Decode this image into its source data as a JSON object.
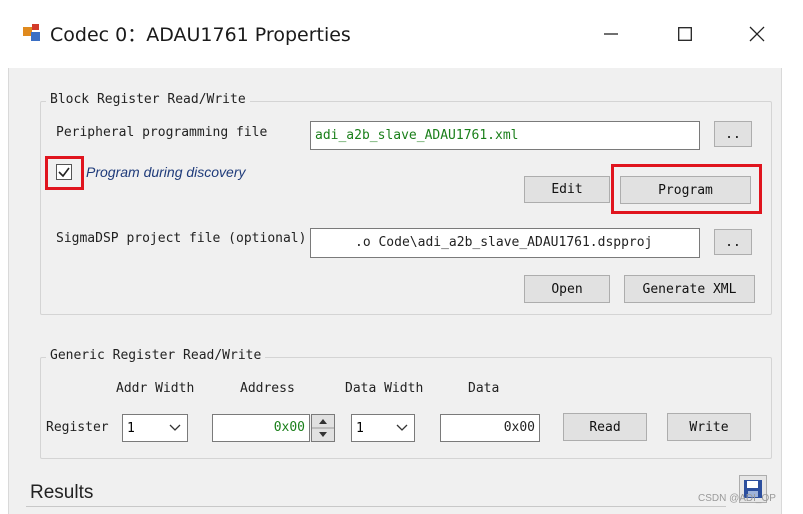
{
  "window": {
    "title": "Codec 0：ADAU1761 Properties",
    "controls": [
      "minimize-icon",
      "maximize-icon",
      "close-icon"
    ]
  },
  "block_rw": {
    "legend": "Block Register Read/Write",
    "peripheral_label": "Peripheral programming file",
    "peripheral_value": "adi_a2b_slave_ADAU1761.xml",
    "browse1": "..",
    "program_during_discovery_label": "Program during discovery",
    "program_during_discovery_checked": true,
    "edit_label": "Edit",
    "program_label": "Program",
    "sigma_label": "SigmaDSP project file (optional)",
    "sigma_value": ".o Code\\adi_a2b_slave_ADAU1761.dspproj",
    "browse2": "..",
    "open_label": "Open",
    "generate_label": "Generate XML"
  },
  "generic_rw": {
    "legend": "Generic Register Read/Write",
    "headers": {
      "addr_width": "Addr Width",
      "address": "Address",
      "data_width": "Data Width",
      "data": "Data"
    },
    "row_label": "Register",
    "addr_width_value": "1",
    "address_value": "0x00",
    "data_width_value": "1",
    "data_value": "0x00",
    "read_label": "Read",
    "write_label": "Write"
  },
  "results": {
    "label": "Results"
  },
  "watermark": "CSDN @ADI_OP",
  "colors": {
    "highlight": "#e0141e",
    "file_text": "#1a7f1a",
    "italic_label": "#1f3b7a"
  }
}
